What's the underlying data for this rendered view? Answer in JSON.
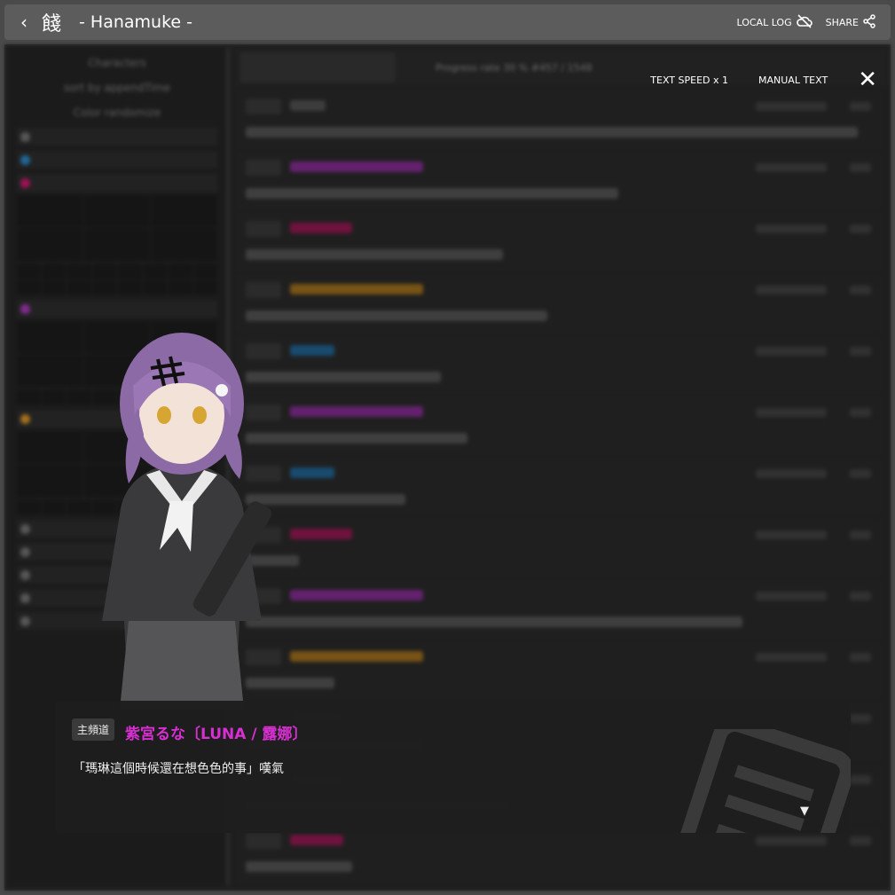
{
  "header": {
    "back_icon": "‹",
    "room_icon": "餞",
    "title": "- Hanamuke -",
    "local_log_label": "LOCAL LOG",
    "share_label": "SHARE"
  },
  "controls": {
    "text_speed_label": "TEXT SPEED x 1",
    "manual_text_label": "MANUAL TEXT",
    "close_icon": "✕"
  },
  "background": {
    "characters_label": "Characters",
    "sort_label": "sort by appendTime",
    "color_label": "Color randomize",
    "progress_label": "Progress rate 30 % #457 / 1548"
  },
  "message": {
    "channel": "主頻道",
    "speaker": "紫宮るな〔LUNA / 露娜〕",
    "text": "「瑪琳這個時候還在想色色的事」嘆氣",
    "more_icon": "▼"
  },
  "colors": {
    "speaker": "#d72fd1",
    "purple_name": "#b33cc6",
    "orange_name": "#e39a2a",
    "blue_name": "#2d8fd0",
    "magenta_name": "#d81b72"
  }
}
